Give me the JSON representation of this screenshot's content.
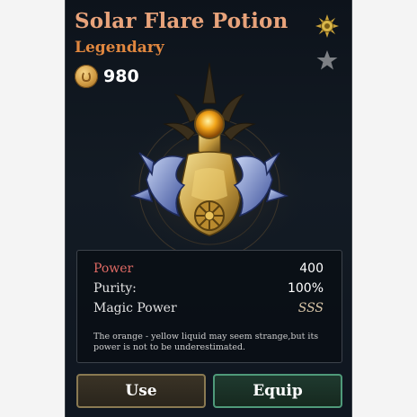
{
  "item": {
    "name": "Solar Flare Potion",
    "rarity": "Legendary",
    "price": "980"
  },
  "icons": {
    "currency": "gold-coin-icon",
    "badge": "sun-emblem-icon",
    "favorite": "star-icon"
  },
  "stats": [
    {
      "label": "Power",
      "value": "400"
    },
    {
      "label": "Purity:",
      "value": "100%"
    },
    {
      "label": "Magic Power",
      "value": "SSS"
    }
  ],
  "description": "The orange - yellow liquid may seem strange,but its power is not to be underestimated.",
  "buttons": {
    "use": "Use",
    "equip": "Equip"
  },
  "colors": {
    "title": "#e8a37b",
    "rarity": "#e0873f",
    "power_label": "#e06a64",
    "equip_border": "#4f9a7a",
    "use_border": "#8a7a52"
  }
}
